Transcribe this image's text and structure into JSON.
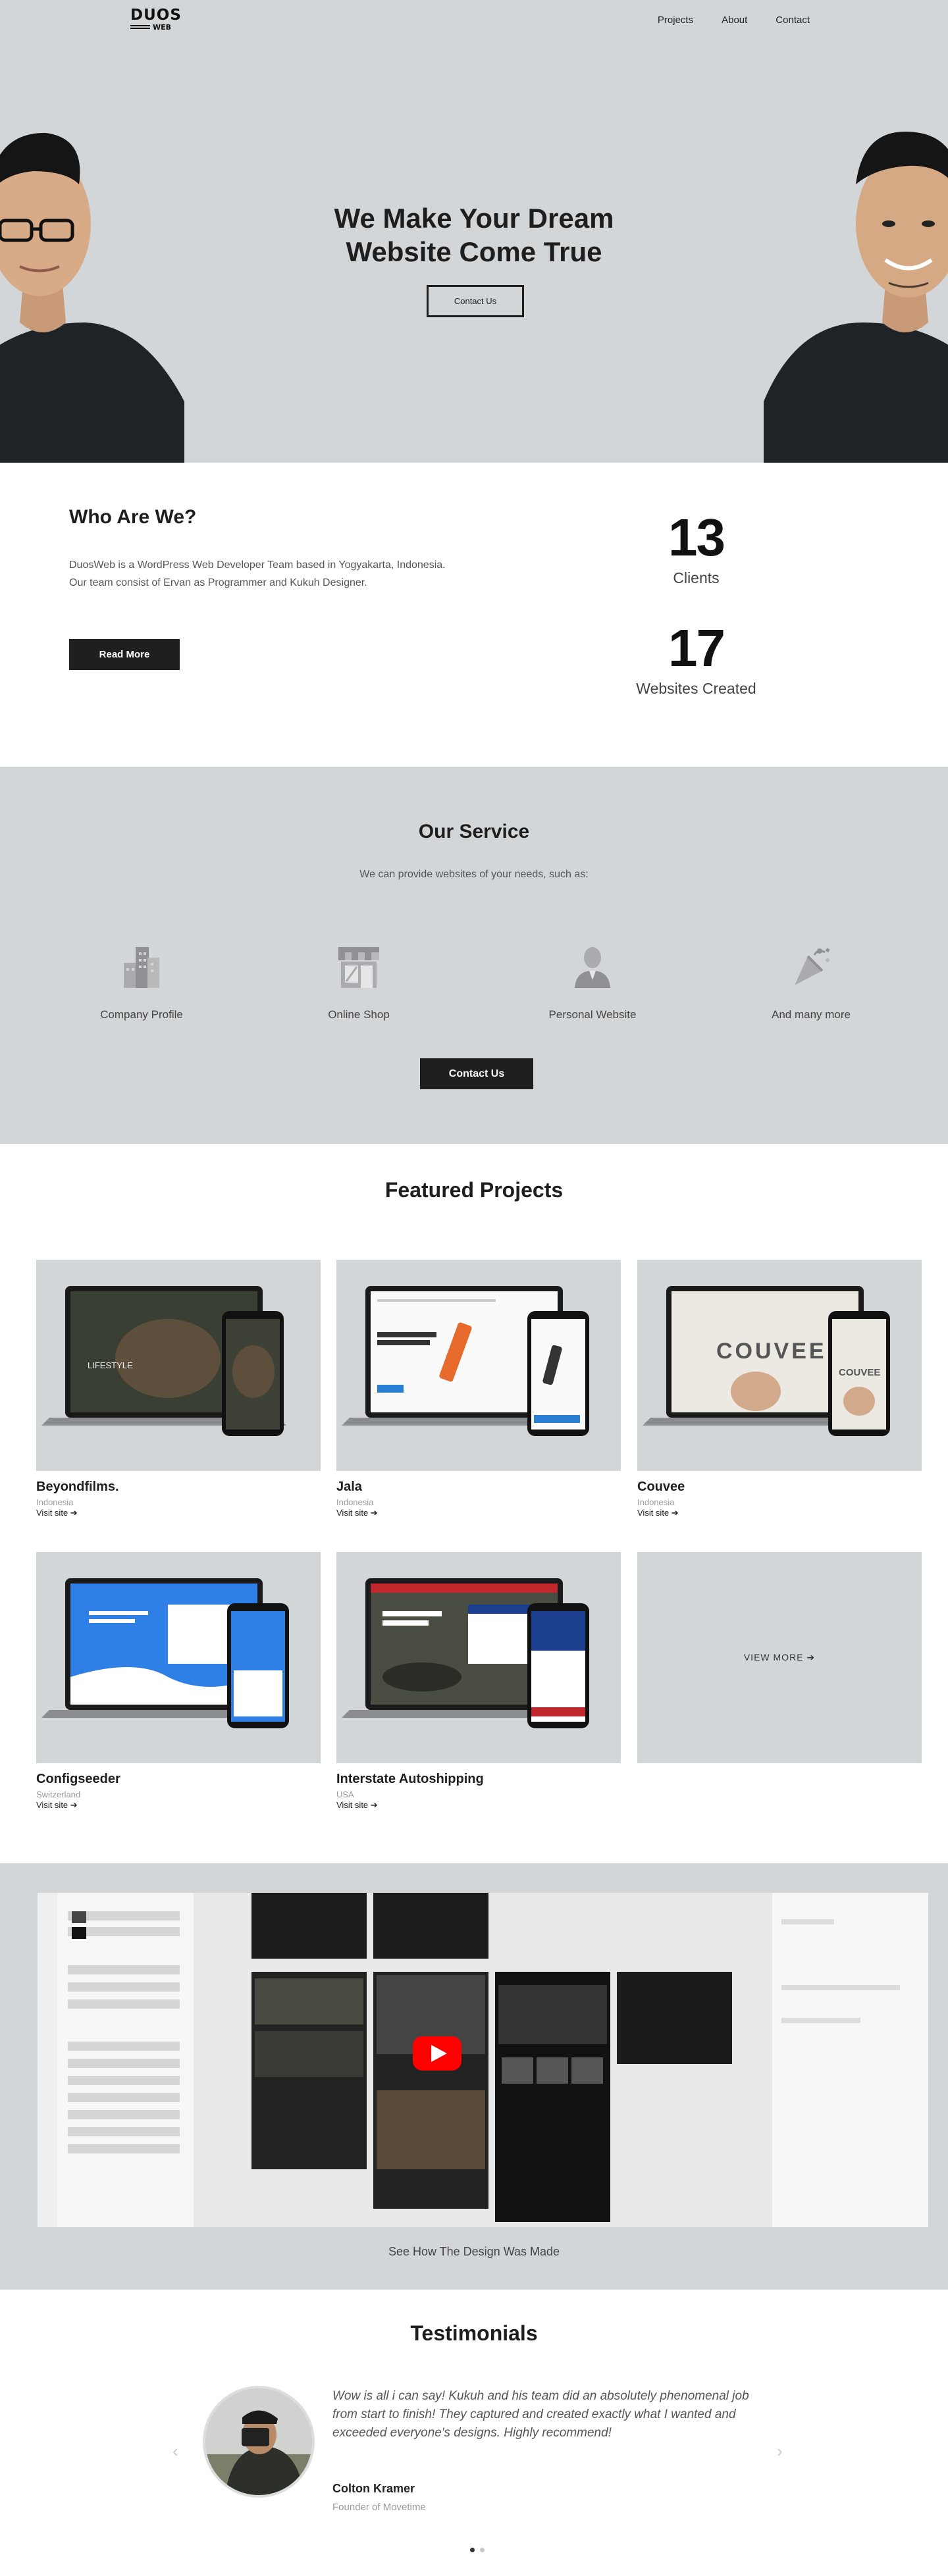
{
  "header": {
    "logo_line1": "DUOS",
    "logo_line2": "WEB",
    "nav": [
      "Projects",
      "About",
      "Contact"
    ]
  },
  "hero": {
    "title_line1": "We Make Your Dream",
    "title_line2": "Website Come True",
    "cta": "Contact Us"
  },
  "about": {
    "title": "Who Are We?",
    "text": "DuosWeb is a WordPress Web Developer Team based in Yogyakarta, Indonesia. Our team consist of Ervan as Programmer and Kukuh Designer.",
    "button": "Read More",
    "stats": [
      {
        "value": "13",
        "label": "Clients"
      },
      {
        "value": "17",
        "label": "Websites Created"
      }
    ]
  },
  "service": {
    "title": "Our Service",
    "subtitle": "We can provide websites of your needs, such as:",
    "items": [
      {
        "label": "Company Profile",
        "icon": "building-icon"
      },
      {
        "label": "Online Shop",
        "icon": "shop-icon"
      },
      {
        "label": "Personal Website",
        "icon": "person-icon"
      },
      {
        "label": "And many more",
        "icon": "confetti-icon"
      }
    ],
    "button": "Contact Us"
  },
  "projects": {
    "title": "Featured Projects",
    "items": [
      {
        "name": "Beyondfilms.",
        "country": "Indonesia",
        "link": "Visit site ➔"
      },
      {
        "name": "Jala",
        "country": "Indonesia",
        "link": "Visit site ➔"
      },
      {
        "name": "Couvee",
        "country": "Indonesia",
        "link": "Visit site ➔"
      },
      {
        "name": "Configseeder",
        "country": "Switzerland",
        "link": "Visit site ➔"
      },
      {
        "name": "Interstate Autoshipping",
        "country": "USA",
        "link": "Visit site ➔"
      }
    ],
    "view_more": "VIEW MORE ➔",
    "screen_text": {
      "beyond": "LIFESTYLE",
      "couvee": "COUVEE"
    }
  },
  "design": {
    "caption": "See How The Design Was Made"
  },
  "testimonials": {
    "title": "Testimonials",
    "quote": "Wow is all i can say! Kukuh and his team did an absolutely phenomenal job from start to finish! They captured and created exactly what I wanted and exceeded everyone's designs. Highly recommend!",
    "name": "Colton Kramer",
    "role": "Founder of Movetime"
  },
  "colors": {
    "gray_bg": "#d3d6d9",
    "dark": "#1f1f1f",
    "youtube_red": "#ff0000"
  }
}
